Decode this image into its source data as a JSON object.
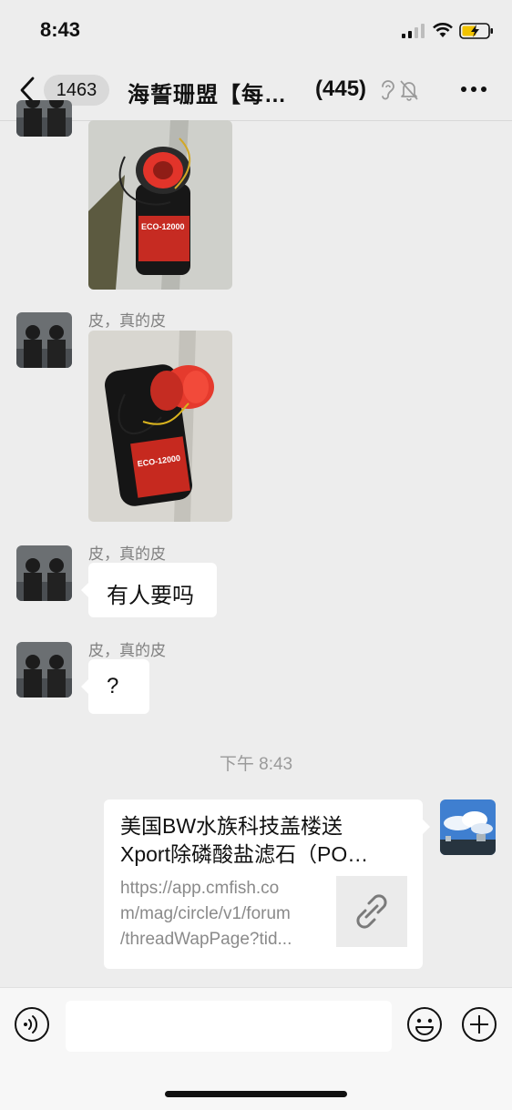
{
  "status_bar": {
    "time": "8:43"
  },
  "header": {
    "unread_count": "1463",
    "title": "海誓珊盟【每…",
    "member_count": "(445)"
  },
  "messages": [
    {
      "type": "image",
      "description": "aquarium pump ECO-12000"
    },
    {
      "type": "image",
      "sender": "皮，真的皮",
      "description": "aquarium pump ECO-12000"
    },
    {
      "type": "text",
      "sender": "皮，真的皮",
      "text": "有人要吗"
    },
    {
      "type": "text",
      "sender": "皮，真的皮",
      "text": "?"
    }
  ],
  "timestamp": "下午 8:43",
  "link_card": {
    "title_line1": "美国BW水族科技盖楼送",
    "title_line2": "Xport除磷酸盐滤石（PO…",
    "url_line1": "https://app.cmfish.co",
    "url_line2": "m/mag/circle/v1/forum",
    "url_line3": "/threadWapPage?tid..."
  },
  "input_bar": {
    "placeholder": ""
  },
  "icons": [
    "back-icon",
    "ear-icon",
    "mute-icon",
    "more-icon",
    "voice-icon",
    "emoji-icon",
    "plus-icon",
    "link-icon"
  ]
}
